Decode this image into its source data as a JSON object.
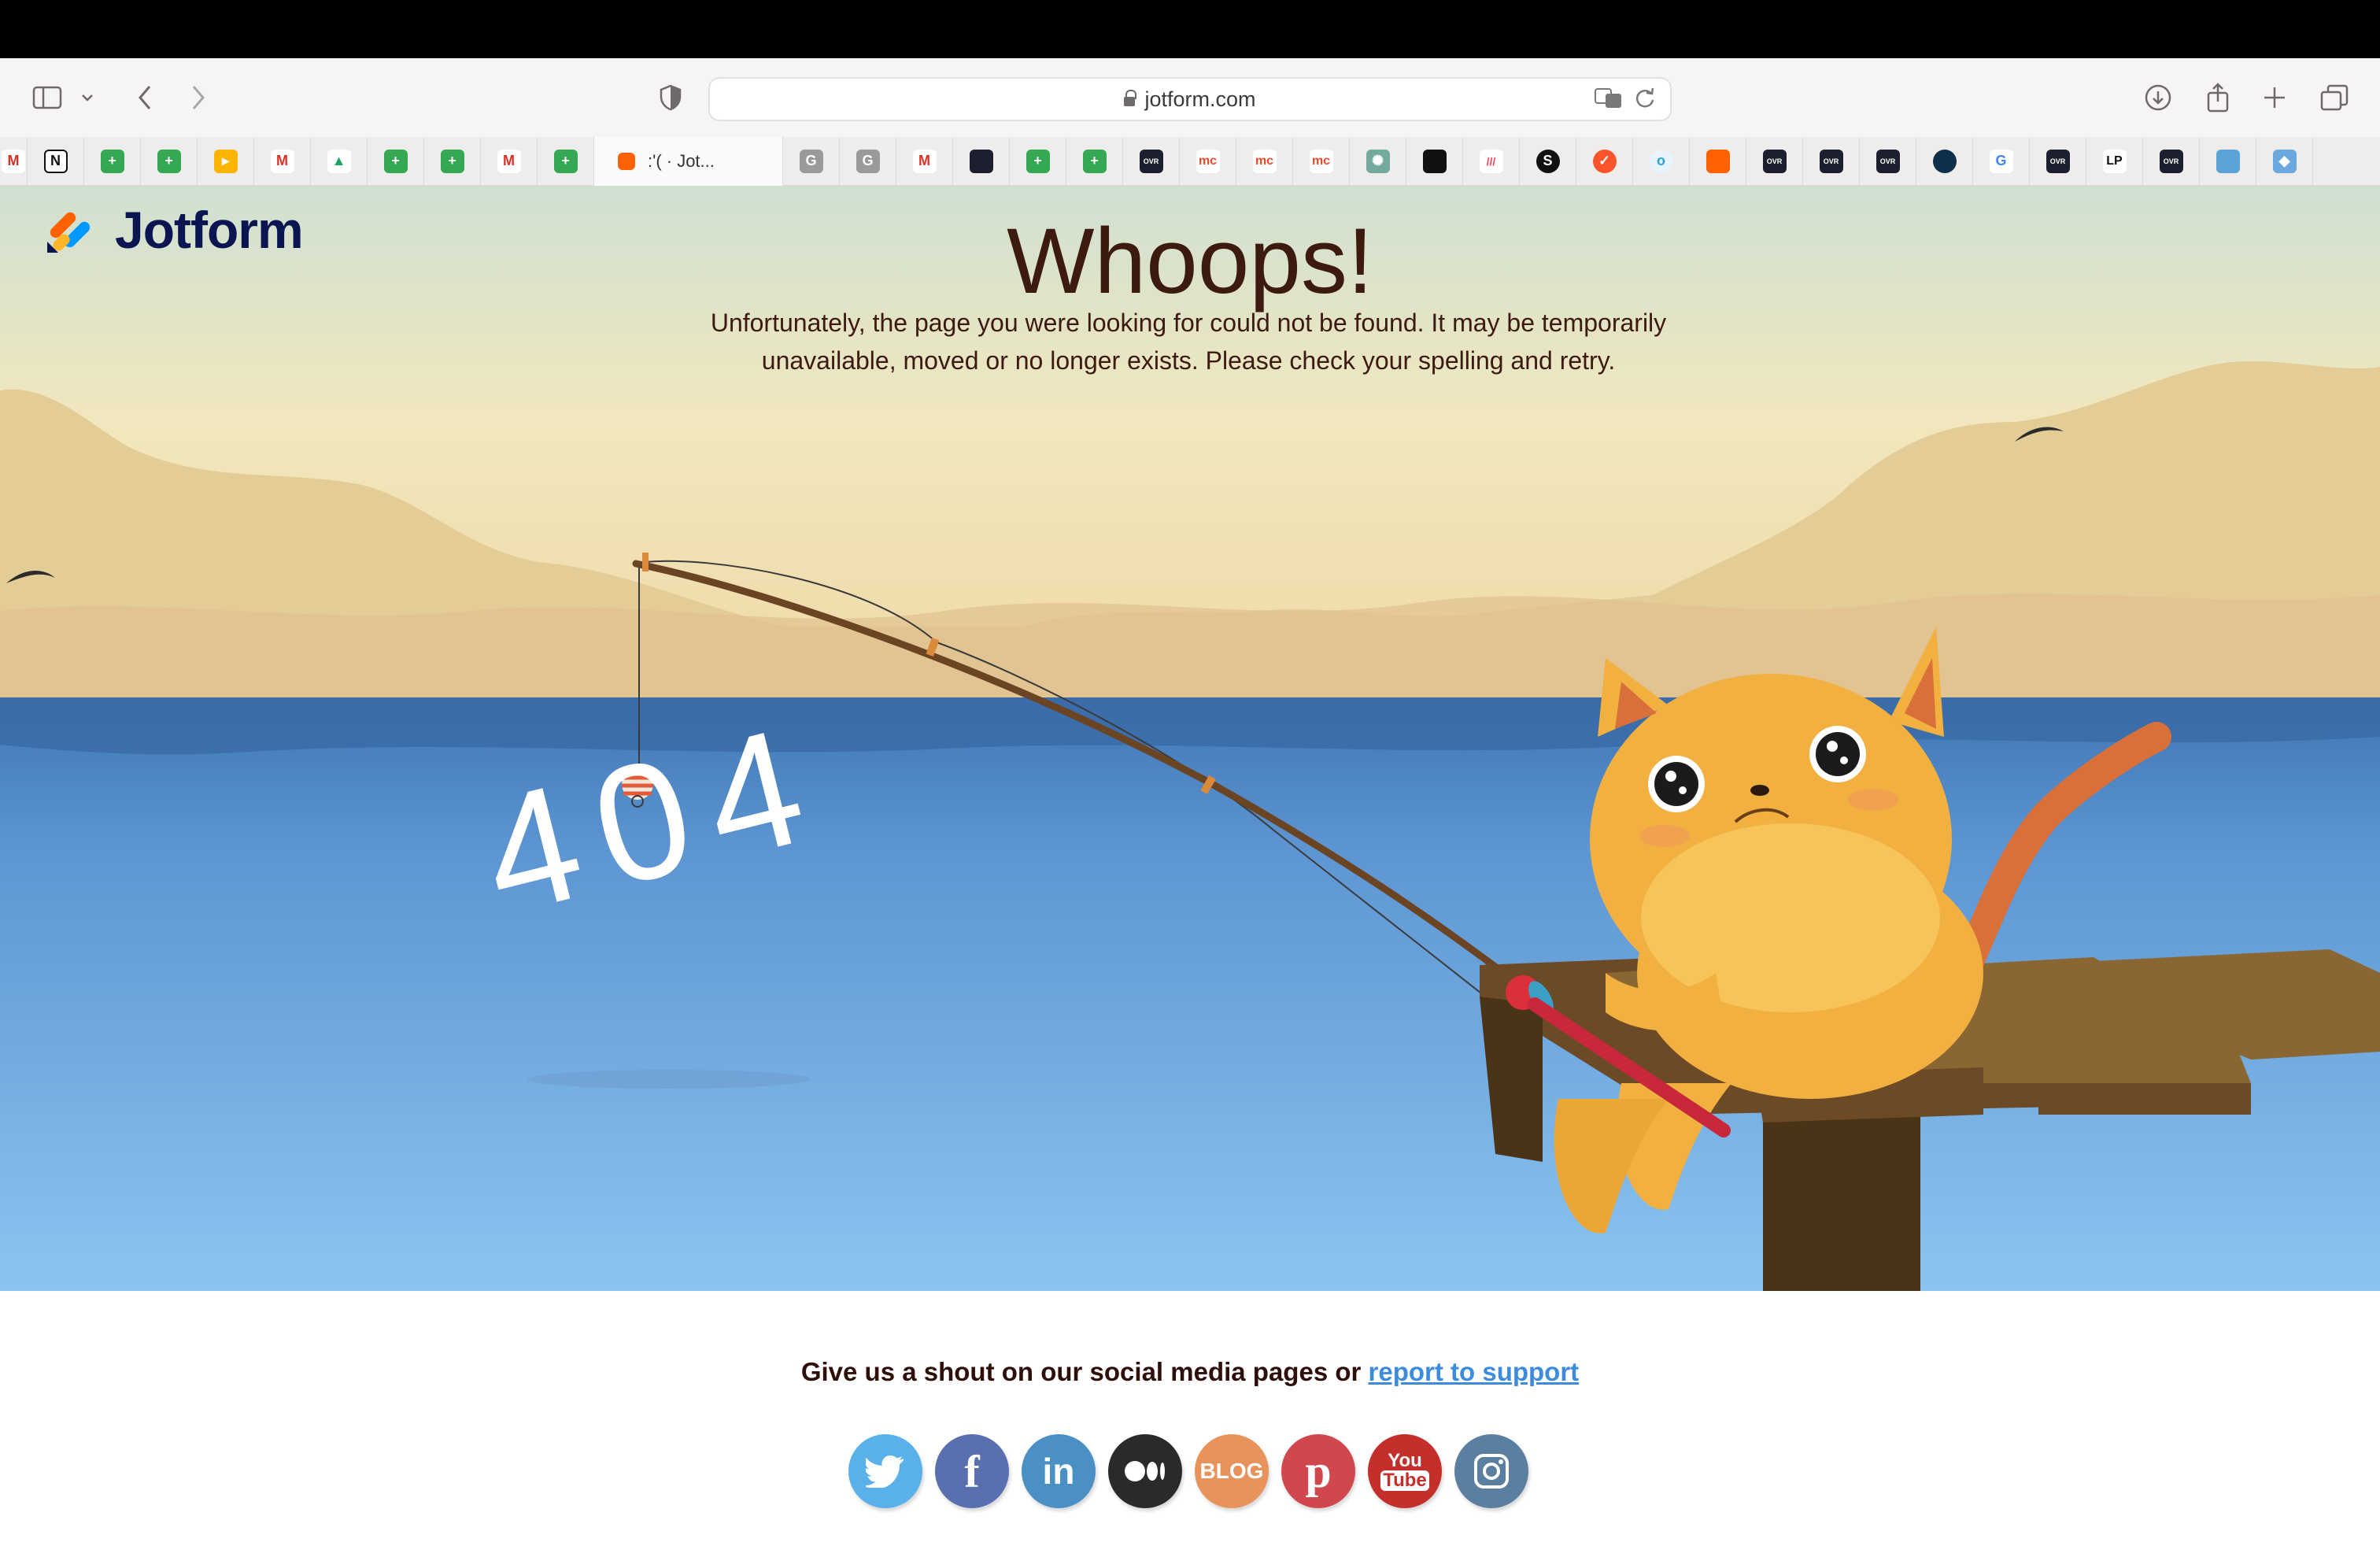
{
  "browser": {
    "url": "jotform.com",
    "active_tab_title": ":'( · Jot...",
    "bookmark_icons": [
      "gmail-icon",
      "notion-icon",
      "sheets-icon",
      "sheets-icon",
      "airtable-icon",
      "gmail-icon",
      "drive-icon",
      "sheets-icon",
      "sheets-icon",
      "gmail-icon",
      "sheets-icon"
    ],
    "right_tab_icons": [
      "g-icon",
      "g-icon",
      "gmail-icon",
      "dark-icon",
      "sheets-icon",
      "sheets-icon",
      "overwatt-icon",
      "mc-icon",
      "mc-icon",
      "mc-icon",
      "chatgpt-icon",
      "dark-icon",
      "monday-icon",
      "s-icon",
      "brave-icon",
      "ring-icon",
      "jotform-icon",
      "overwatt-icon",
      "overwatt-icon",
      "overwatt-icon",
      "circle-icon",
      "google-icon",
      "overwatt-icon",
      "lp-icon",
      "overwatt-icon",
      "cube-icon",
      "tag-icon",
      "google-icon"
    ]
  },
  "brand": {
    "name": "Jotform",
    "color": "#0a1551"
  },
  "hero": {
    "title": "Whoops!",
    "message_line1": "Unfortunately, the page you were looking for could not be found. It may be temporarily",
    "message_line2": "unavailable, moved or no longer exists. Please check your spelling and retry.",
    "code": "404"
  },
  "footer": {
    "shout_text": "Give us a shout on our social media pages or ",
    "support_link": "report to support",
    "social": [
      {
        "name": "twitter",
        "color": "#5ab0e8"
      },
      {
        "name": "facebook",
        "color": "#5a6fb0"
      },
      {
        "name": "linkedin",
        "color": "#4a90c5"
      },
      {
        "name": "medium",
        "color": "#2a2a2a"
      },
      {
        "name": "blog",
        "color": "#e9935c",
        "label": "BLOG"
      },
      {
        "name": "pinterest",
        "color": "#d0474d"
      },
      {
        "name": "youtube",
        "color": "#c52f2b",
        "label1": "You",
        "label2": "Tube"
      },
      {
        "name": "instagram",
        "color": "#5a7fa0"
      }
    ]
  }
}
